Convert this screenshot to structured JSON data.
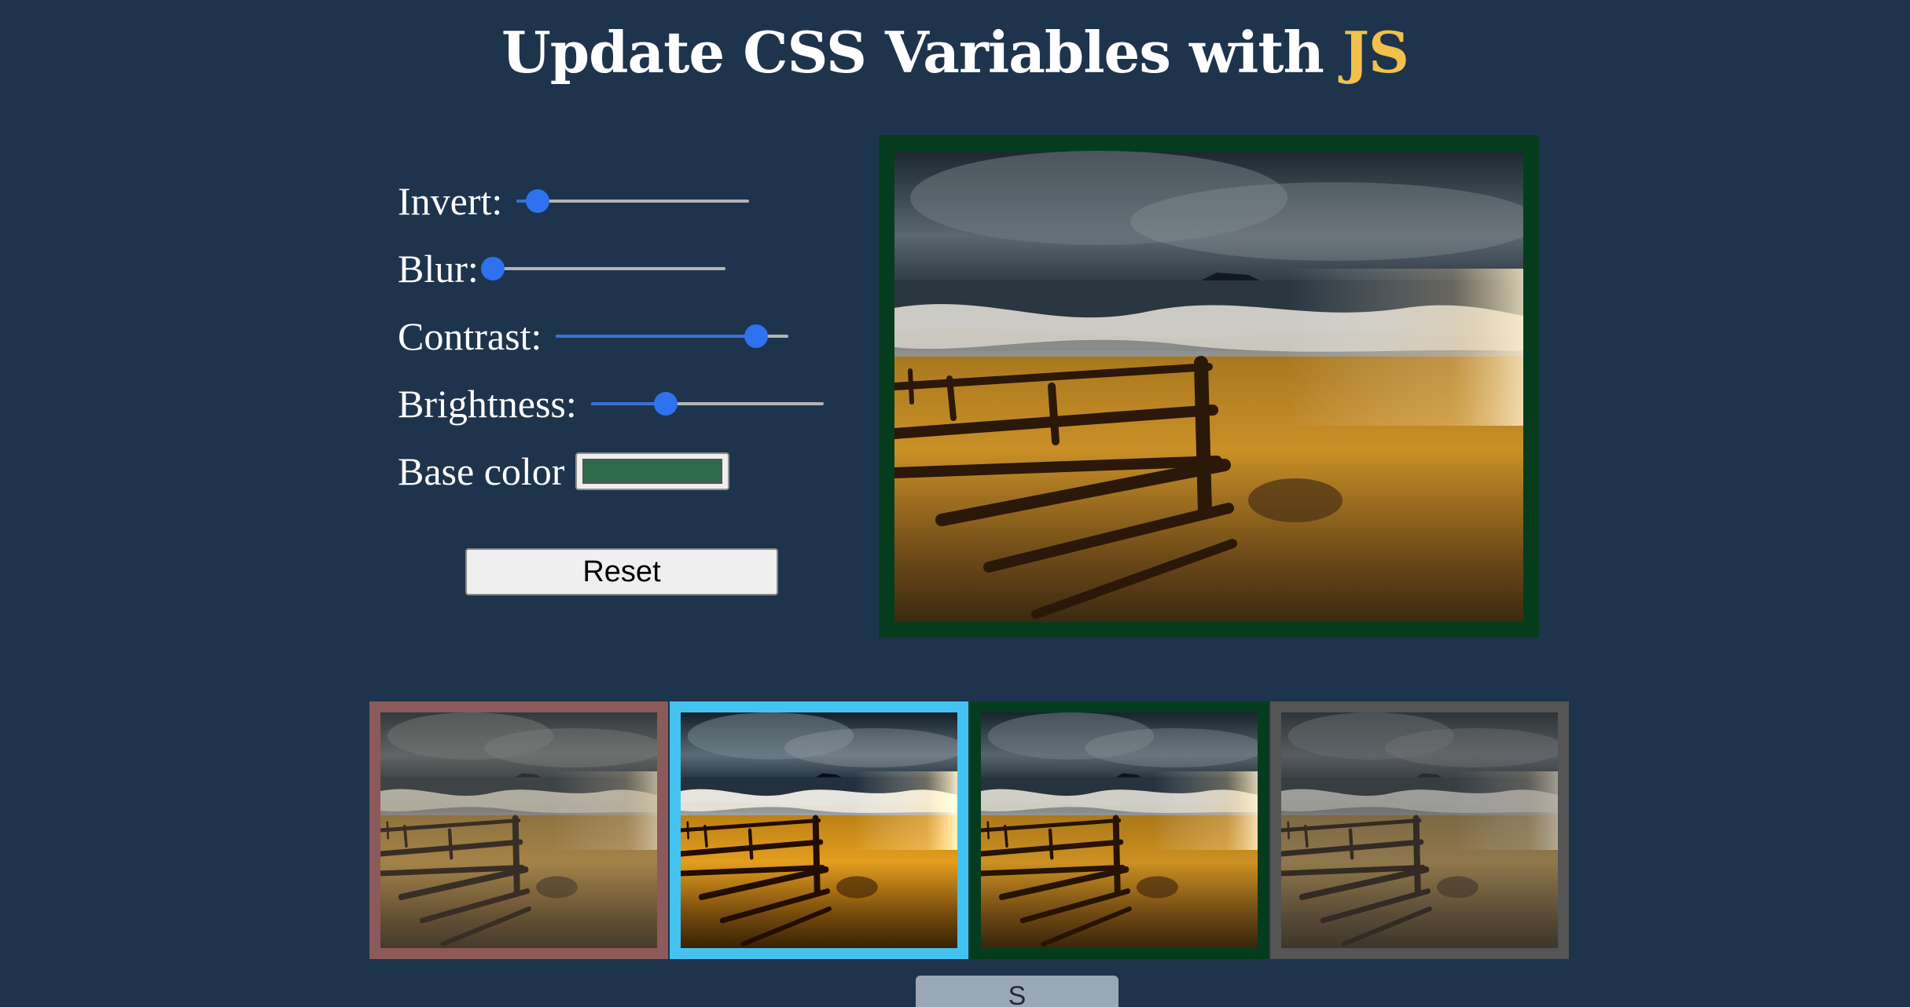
{
  "title": {
    "main": "Update CSS Variables with ",
    "accent": "JS",
    "accent_color": "#f1c14c"
  },
  "controls": {
    "invert": {
      "label": "Invert:",
      "value": 0.09
    },
    "blur": {
      "label": "Blur:",
      "value": 0.0
    },
    "contrast": {
      "label": "Contrast:",
      "value": 0.86
    },
    "brightness": {
      "label": "Brightness:",
      "value": 0.32
    },
    "base_color": {
      "label": "Base color",
      "value": "#2e6b4b"
    }
  },
  "reset_label": "Reset",
  "main_image": {
    "border_color": "#063c1e"
  },
  "thumbnails": [
    {
      "border_color": "#8c5a5a",
      "filter": "sepia(0.25) contrast(0.75) brightness(0.9)"
    },
    {
      "border_color": "#45c3f0",
      "filter": "contrast(1.12) brightness(1.08)"
    },
    {
      "border_color": "#063c1e",
      "filter": "contrast(1.05)"
    },
    {
      "border_color": "#555555",
      "filter": "grayscale(0.35) contrast(0.75) brightness(0.85)"
    }
  ],
  "partial_button_label": "S"
}
